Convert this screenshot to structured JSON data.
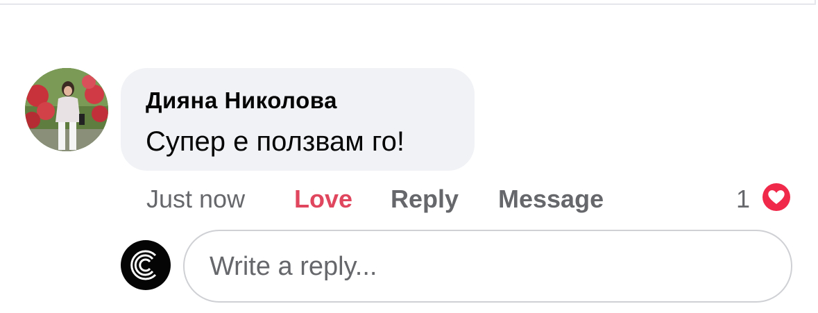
{
  "comment": {
    "author": "Дияна Николова",
    "text": "Супер е ползвам го!",
    "timestamp": "Just now",
    "reaction_count": "1",
    "reaction_type": "heart-icon",
    "actions": {
      "love": "Love",
      "reply": "Reply",
      "message": "Message"
    }
  },
  "reply_box": {
    "placeholder": "Write a reply..."
  },
  "colors": {
    "love_active": "#e0475e",
    "secondary_text": "#65676b",
    "bubble_bg": "#f0f2f5",
    "heart_badge": "#f0284a"
  }
}
